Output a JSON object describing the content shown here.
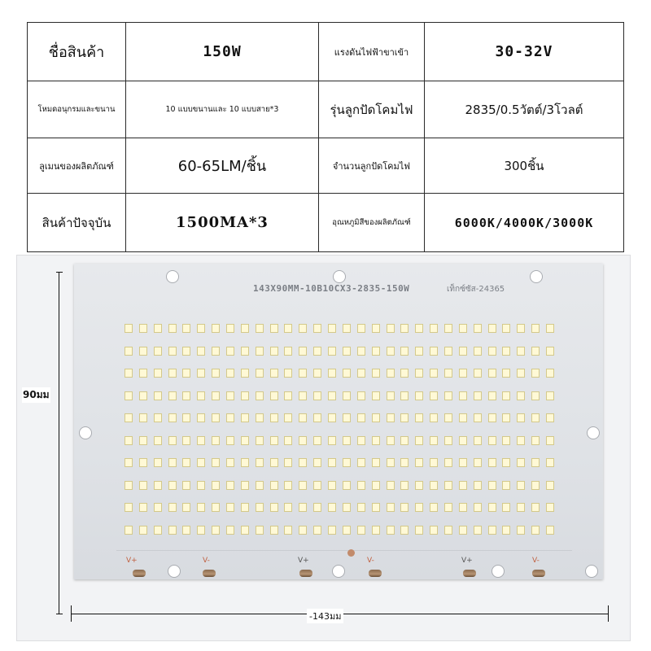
{
  "specs": {
    "r1": {
      "c1": "ชื่อสินค้า",
      "c2": "150W",
      "c3": "แรงดันไฟฟ้าขาเข้า",
      "c4": "30-32V"
    },
    "r2": {
      "c1": "โหมดอนุกรมและขนาน",
      "c2": "10 แบบขนานและ 10 แบบสาย*3",
      "c3": "รุ่นลูกปัดโคมไฟ",
      "c4": "2835/0.5วัตต์/3โวลต์"
    },
    "r3": {
      "c1": "ลูเมนของผลิตภัณฑ์",
      "c2": "60-65LM/ชิ้น",
      "c3": "จำนวนลูกปัดโคมไฟ",
      "c4": "300ชิ้น"
    },
    "r4": {
      "c1": "สินค้าปัจจุบัน",
      "c2": "1500MA*3",
      "c3": "อุณหภูมิสีของผลิตภัณฑ์",
      "c4": "6000K/4000K/3000K"
    }
  },
  "board": {
    "silkscreen": "143X90MM-10B10CX3-2835-150W",
    "code": "เท็กซ์ซัส-24365",
    "pads": [
      "V+",
      "V-",
      "V+",
      "V-",
      "V+",
      "V-"
    ],
    "led_rows": 10,
    "led_cols": 30
  },
  "dimensions": {
    "height_label": "90มม",
    "width_label": "-143มม"
  },
  "colors": {
    "led": "#fff9d6",
    "board": "#e2e5e9",
    "pad_label": "#c06040"
  }
}
